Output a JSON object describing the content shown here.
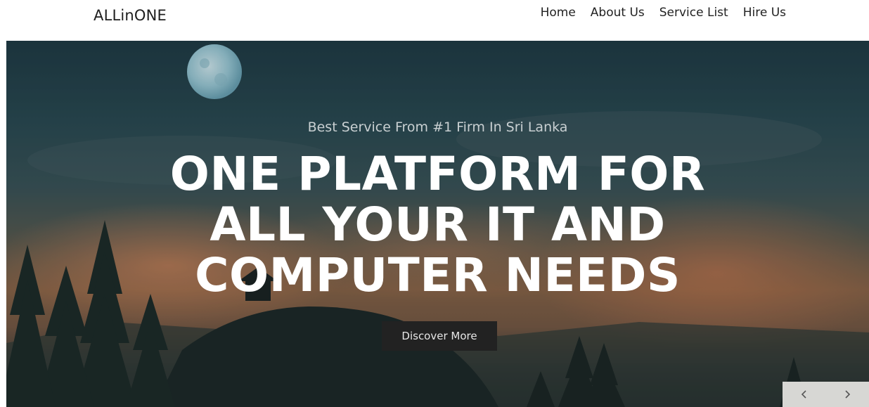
{
  "header": {
    "logo": "ALLinONE",
    "nav": [
      {
        "label": "Home"
      },
      {
        "label": "About Us"
      },
      {
        "label": "Service List"
      },
      {
        "label": "Hire Us"
      }
    ]
  },
  "hero": {
    "subtitle": "Best Service From #1 Firm In Sri Lanka",
    "headline_lines": [
      "ONE PLATFORM FOR",
      "ALL YOUR IT AND",
      "COMPUTER NEEDS"
    ],
    "cta_label": "Discover More"
  },
  "slider": {
    "prev_icon": "chevron-left-icon",
    "next_icon": "chevron-right-icon"
  },
  "colors": {
    "cta_background": "#222222",
    "header_background": "#ffffff",
    "headline_text": "#ffffff"
  }
}
